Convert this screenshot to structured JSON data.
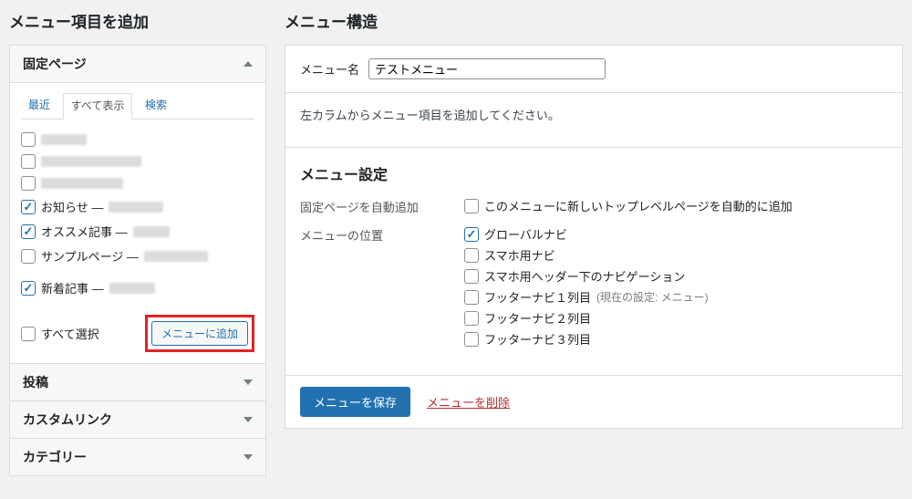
{
  "left": {
    "heading": "メニュー項目を追加",
    "panels": {
      "fixed_pages": "固定ページ",
      "posts": "投稿",
      "custom_links": "カスタムリンク",
      "categories": "カテゴリー"
    },
    "tabs": {
      "recent": "最近",
      "all": "すべて表示",
      "search": "検索"
    },
    "items": {
      "notice": "お知らせ —",
      "recommend": "オススメ記事 —",
      "sample": "サンプルページ —",
      "new_posts": "新着記事 —"
    },
    "select_all": "すべて選択",
    "add_button": "メニューに追加"
  },
  "right": {
    "heading": "メニュー構造",
    "menu_name_label": "メニュー名",
    "menu_name_value": "テストメニュー",
    "instruction": "左カラムからメニュー項目を追加してください。",
    "settings_heading": "メニュー設定",
    "auto_add_label": "固定ページを自動追加",
    "auto_add_opt": "このメニューに新しいトップレベルページを自動的に追加",
    "location_label": "メニューの位置",
    "locations": {
      "global": "グローバルナビ",
      "sp": "スマホ用ナビ",
      "sp_header": "スマホ用ヘッダー下のナビゲーション",
      "footer1": "フッターナビ１列目",
      "footer1_hint": "(現在の設定: メニュー)",
      "footer2": "フッターナビ２列目",
      "footer3": "フッターナビ３列目"
    },
    "save_button": "メニューを保存",
    "delete_link": "メニューを削除"
  }
}
